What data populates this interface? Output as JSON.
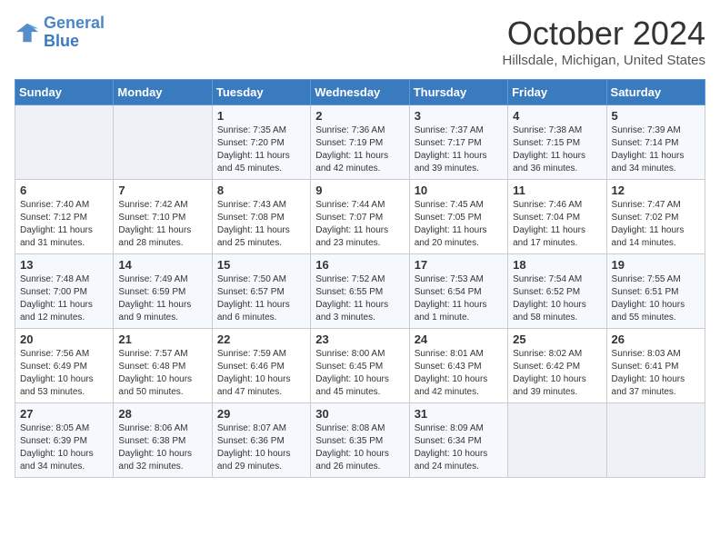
{
  "header": {
    "logo_line1": "General",
    "logo_line2": "Blue",
    "month": "October 2024",
    "location": "Hillsdale, Michigan, United States"
  },
  "days_of_week": [
    "Sunday",
    "Monday",
    "Tuesday",
    "Wednesday",
    "Thursday",
    "Friday",
    "Saturday"
  ],
  "weeks": [
    [
      {
        "day": "",
        "info": ""
      },
      {
        "day": "",
        "info": ""
      },
      {
        "day": "1",
        "info": "Sunrise: 7:35 AM\nSunset: 7:20 PM\nDaylight: 11 hours and 45 minutes."
      },
      {
        "day": "2",
        "info": "Sunrise: 7:36 AM\nSunset: 7:19 PM\nDaylight: 11 hours and 42 minutes."
      },
      {
        "day": "3",
        "info": "Sunrise: 7:37 AM\nSunset: 7:17 PM\nDaylight: 11 hours and 39 minutes."
      },
      {
        "day": "4",
        "info": "Sunrise: 7:38 AM\nSunset: 7:15 PM\nDaylight: 11 hours and 36 minutes."
      },
      {
        "day": "5",
        "info": "Sunrise: 7:39 AM\nSunset: 7:14 PM\nDaylight: 11 hours and 34 minutes."
      }
    ],
    [
      {
        "day": "6",
        "info": "Sunrise: 7:40 AM\nSunset: 7:12 PM\nDaylight: 11 hours and 31 minutes."
      },
      {
        "day": "7",
        "info": "Sunrise: 7:42 AM\nSunset: 7:10 PM\nDaylight: 11 hours and 28 minutes."
      },
      {
        "day": "8",
        "info": "Sunrise: 7:43 AM\nSunset: 7:08 PM\nDaylight: 11 hours and 25 minutes."
      },
      {
        "day": "9",
        "info": "Sunrise: 7:44 AM\nSunset: 7:07 PM\nDaylight: 11 hours and 23 minutes."
      },
      {
        "day": "10",
        "info": "Sunrise: 7:45 AM\nSunset: 7:05 PM\nDaylight: 11 hours and 20 minutes."
      },
      {
        "day": "11",
        "info": "Sunrise: 7:46 AM\nSunset: 7:04 PM\nDaylight: 11 hours and 17 minutes."
      },
      {
        "day": "12",
        "info": "Sunrise: 7:47 AM\nSunset: 7:02 PM\nDaylight: 11 hours and 14 minutes."
      }
    ],
    [
      {
        "day": "13",
        "info": "Sunrise: 7:48 AM\nSunset: 7:00 PM\nDaylight: 11 hours and 12 minutes."
      },
      {
        "day": "14",
        "info": "Sunrise: 7:49 AM\nSunset: 6:59 PM\nDaylight: 11 hours and 9 minutes."
      },
      {
        "day": "15",
        "info": "Sunrise: 7:50 AM\nSunset: 6:57 PM\nDaylight: 11 hours and 6 minutes."
      },
      {
        "day": "16",
        "info": "Sunrise: 7:52 AM\nSunset: 6:55 PM\nDaylight: 11 hours and 3 minutes."
      },
      {
        "day": "17",
        "info": "Sunrise: 7:53 AM\nSunset: 6:54 PM\nDaylight: 11 hours and 1 minute."
      },
      {
        "day": "18",
        "info": "Sunrise: 7:54 AM\nSunset: 6:52 PM\nDaylight: 10 hours and 58 minutes."
      },
      {
        "day": "19",
        "info": "Sunrise: 7:55 AM\nSunset: 6:51 PM\nDaylight: 10 hours and 55 minutes."
      }
    ],
    [
      {
        "day": "20",
        "info": "Sunrise: 7:56 AM\nSunset: 6:49 PM\nDaylight: 10 hours and 53 minutes."
      },
      {
        "day": "21",
        "info": "Sunrise: 7:57 AM\nSunset: 6:48 PM\nDaylight: 10 hours and 50 minutes."
      },
      {
        "day": "22",
        "info": "Sunrise: 7:59 AM\nSunset: 6:46 PM\nDaylight: 10 hours and 47 minutes."
      },
      {
        "day": "23",
        "info": "Sunrise: 8:00 AM\nSunset: 6:45 PM\nDaylight: 10 hours and 45 minutes."
      },
      {
        "day": "24",
        "info": "Sunrise: 8:01 AM\nSunset: 6:43 PM\nDaylight: 10 hours and 42 minutes."
      },
      {
        "day": "25",
        "info": "Sunrise: 8:02 AM\nSunset: 6:42 PM\nDaylight: 10 hours and 39 minutes."
      },
      {
        "day": "26",
        "info": "Sunrise: 8:03 AM\nSunset: 6:41 PM\nDaylight: 10 hours and 37 minutes."
      }
    ],
    [
      {
        "day": "27",
        "info": "Sunrise: 8:05 AM\nSunset: 6:39 PM\nDaylight: 10 hours and 34 minutes."
      },
      {
        "day": "28",
        "info": "Sunrise: 8:06 AM\nSunset: 6:38 PM\nDaylight: 10 hours and 32 minutes."
      },
      {
        "day": "29",
        "info": "Sunrise: 8:07 AM\nSunset: 6:36 PM\nDaylight: 10 hours and 29 minutes."
      },
      {
        "day": "30",
        "info": "Sunrise: 8:08 AM\nSunset: 6:35 PM\nDaylight: 10 hours and 26 minutes."
      },
      {
        "day": "31",
        "info": "Sunrise: 8:09 AM\nSunset: 6:34 PM\nDaylight: 10 hours and 24 minutes."
      },
      {
        "day": "",
        "info": ""
      },
      {
        "day": "",
        "info": ""
      }
    ]
  ]
}
